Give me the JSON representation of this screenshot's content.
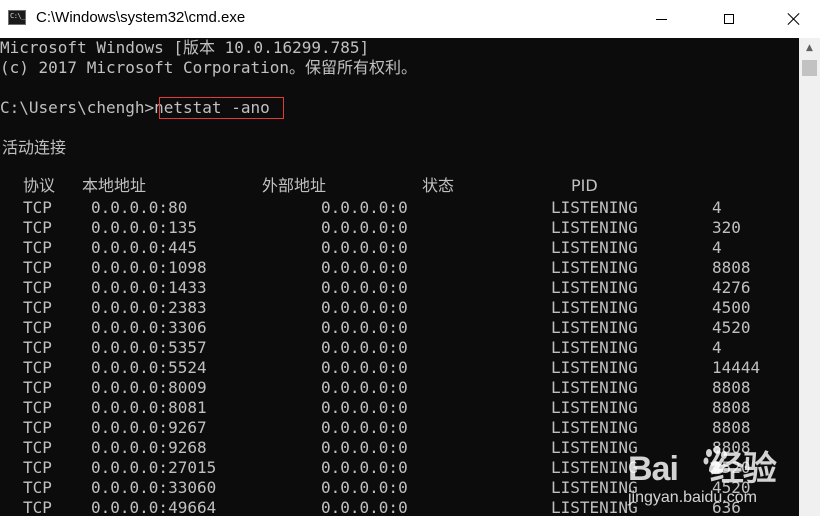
{
  "window": {
    "title": "C:\\Windows\\system32\\cmd.exe",
    "icon_text": "C:\\_",
    "icon": "console-icon",
    "minimize_icon": "minimize-icon",
    "maximize_icon": "maximize-icon",
    "close_icon": "close-icon"
  },
  "console": {
    "banner_line1": "Microsoft Windows [版本 10.0.16299.785]",
    "banner_line2": "(c) 2017 Microsoft Corporation。保留所有权利。",
    "prompt": "C:\\Users\\chengh>",
    "command": "netstat -ano",
    "section_title": "活动连接",
    "headers": {
      "proto": "协议",
      "local": "本地地址",
      "foreign": "外部地址",
      "state": "状态",
      "pid": "PID"
    },
    "rows": [
      {
        "proto": "TCP",
        "local": "0.0.0.0:80",
        "foreign": "0.0.0.0:0",
        "state": "LISTENING",
        "pid": "4"
      },
      {
        "proto": "TCP",
        "local": "0.0.0.0:135",
        "foreign": "0.0.0.0:0",
        "state": "LISTENING",
        "pid": "320"
      },
      {
        "proto": "TCP",
        "local": "0.0.0.0:445",
        "foreign": "0.0.0.0:0",
        "state": "LISTENING",
        "pid": "4"
      },
      {
        "proto": "TCP",
        "local": "0.0.0.0:1098",
        "foreign": "0.0.0.0:0",
        "state": "LISTENING",
        "pid": "8808"
      },
      {
        "proto": "TCP",
        "local": "0.0.0.0:1433",
        "foreign": "0.0.0.0:0",
        "state": "LISTENING",
        "pid": "4276"
      },
      {
        "proto": "TCP",
        "local": "0.0.0.0:2383",
        "foreign": "0.0.0.0:0",
        "state": "LISTENING",
        "pid": "4500"
      },
      {
        "proto": "TCP",
        "local": "0.0.0.0:3306",
        "foreign": "0.0.0.0:0",
        "state": "LISTENING",
        "pid": "4520"
      },
      {
        "proto": "TCP",
        "local": "0.0.0.0:5357",
        "foreign": "0.0.0.0:0",
        "state": "LISTENING",
        "pid": "4"
      },
      {
        "proto": "TCP",
        "local": "0.0.0.0:5524",
        "foreign": "0.0.0.0:0",
        "state": "LISTENING",
        "pid": "14444"
      },
      {
        "proto": "TCP",
        "local": "0.0.0.0:8009",
        "foreign": "0.0.0.0:0",
        "state": "LISTENING",
        "pid": "8808"
      },
      {
        "proto": "TCP",
        "local": "0.0.0.0:8081",
        "foreign": "0.0.0.0:0",
        "state": "LISTENING",
        "pid": "8808"
      },
      {
        "proto": "TCP",
        "local": "0.0.0.0:9267",
        "foreign": "0.0.0.0:0",
        "state": "LISTENING",
        "pid": "8808"
      },
      {
        "proto": "TCP",
        "local": "0.0.0.0:9268",
        "foreign": "0.0.0.0:0",
        "state": "LISTENING",
        "pid": "8808"
      },
      {
        "proto": "TCP",
        "local": "0.0.0.0:27015",
        "foreign": "0.0.0.0:0",
        "state": "LISTENING",
        "pid": "4520"
      },
      {
        "proto": "TCP",
        "local": "0.0.0.0:33060",
        "foreign": "0.0.0.0:0",
        "state": "LISTENING",
        "pid": "4520"
      },
      {
        "proto": "TCP",
        "local": "0.0.0.0:49664",
        "foreign": "0.0.0.0:0",
        "state": "LISTENING",
        "pid": "636"
      }
    ]
  },
  "watermark": {
    "logo_text_left": "Bai",
    "logo_text_right": "经验",
    "sub": "jingyan.baidu.com",
    "icon": "baidu-paw-icon"
  },
  "colors": {
    "console_bg": "#0c0c0c",
    "console_text": "#c0c0c0",
    "highlight_border": "#e53935"
  }
}
